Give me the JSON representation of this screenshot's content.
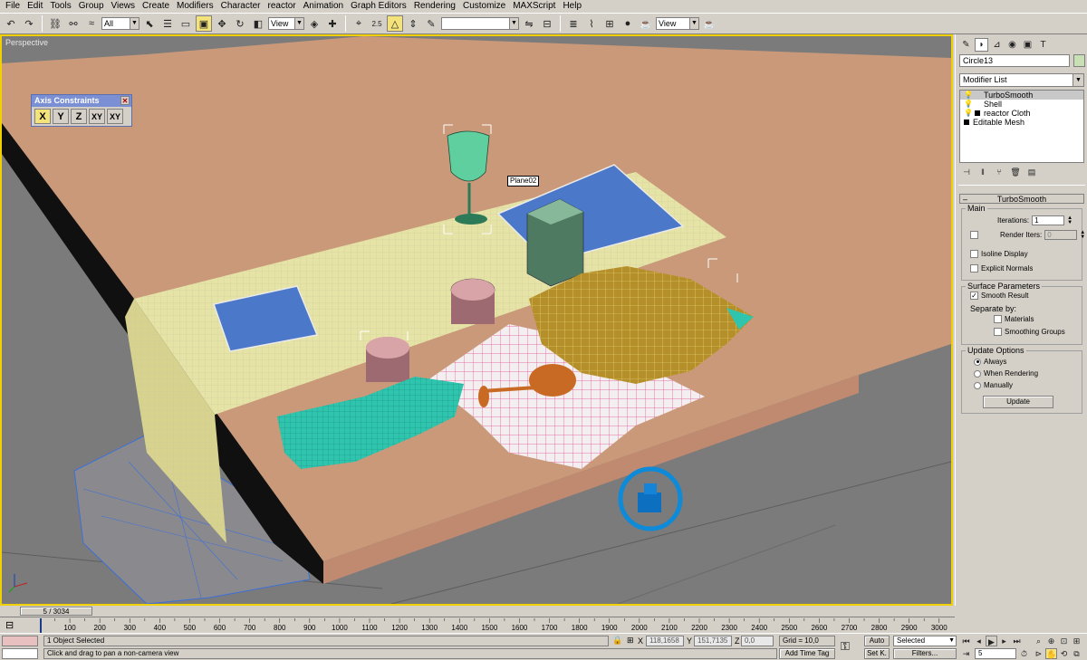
{
  "menu": [
    "File",
    "Edit",
    "Tools",
    "Group",
    "Views",
    "Create",
    "Modifiers",
    "Character",
    "reactor",
    "Animation",
    "Graph Editors",
    "Rendering",
    "Customize",
    "MAXScript",
    "Help"
  ],
  "toolbar": {
    "selection_filter": "All",
    "ref_coord": "View",
    "named_selection": "",
    "render_view": "View",
    "snap_angle_label": "2.5"
  },
  "viewport": {
    "label": "Perspective",
    "object_tooltip": "Plane02"
  },
  "axis_constraints": {
    "title": "Axis Constraints",
    "buttons": [
      "X",
      "Y",
      "Z",
      "XY",
      "XY"
    ]
  },
  "command_panel": {
    "object_name": "Circle13",
    "object_color": "#c9e0b4",
    "modifier_list_label": "Modifier List",
    "stack": [
      {
        "label": "TurboSmooth",
        "selected": true
      },
      {
        "label": "Shell",
        "selected": false
      },
      {
        "label": "reactor Cloth",
        "selected": false
      },
      {
        "label": "Editable Mesh",
        "selected": false
      }
    ],
    "rollout_title": "TurboSmooth",
    "main_group": "Main",
    "iterations_label": "Iterations:",
    "iterations_value": "1",
    "render_iters_label": "Render Iters:",
    "render_iters_value": "0",
    "isoline_label": "Isoline Display",
    "explicit_normals_label": "Explicit Normals",
    "surface_group": "Surface Parameters",
    "smooth_result_label": "Smooth Result",
    "separate_by_label": "Separate by:",
    "materials_label": "Materials",
    "smoothing_groups_label": "Smoothing Groups",
    "update_group": "Update Options",
    "always_label": "Always",
    "when_rendering_label": "When Rendering",
    "manually_label": "Manually",
    "update_button": "Update"
  },
  "timeline": {
    "slider_label": "5 / 3034",
    "ticks": [
      "100",
      "200",
      "300",
      "400",
      "500",
      "600",
      "700",
      "800",
      "900",
      "1000",
      "1100",
      "1200",
      "1300",
      "1400",
      "1500",
      "1600",
      "1700",
      "1800",
      "1900",
      "2000",
      "2100",
      "2200",
      "2300",
      "2400",
      "2500",
      "2600",
      "2700",
      "2800",
      "2900",
      "3000"
    ]
  },
  "status": {
    "selection": "1 Object Selected",
    "prompt": "Click and drag to pan a non-camera view",
    "x_label": "X",
    "x_value": "118,1658",
    "y_label": "Y",
    "y_value": "151,7135",
    "z_label": "Z",
    "z_value": "0,0",
    "grid": "Grid = 10,0",
    "add_time_tag": "Add Time Tag",
    "auto_key": "Auto",
    "set_key": "Set K.",
    "key_filter_select": "Selected",
    "filters": "Filters...",
    "frame": "5"
  }
}
